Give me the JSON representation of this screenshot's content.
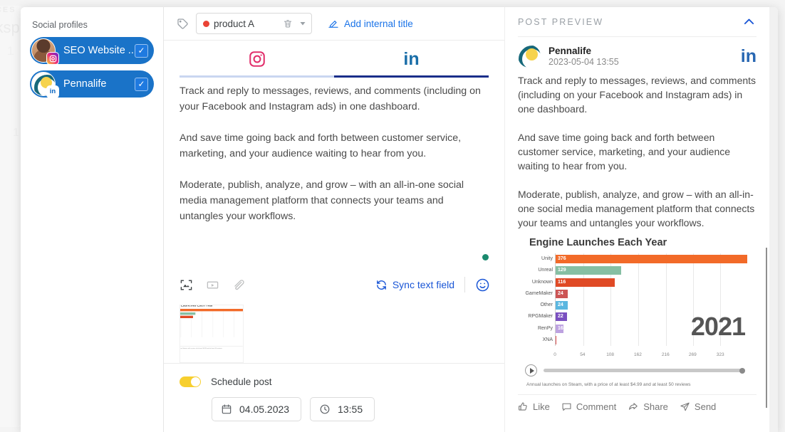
{
  "background": {
    "ghost_eyebrow": "ACES",
    "ghost_title": "orksp",
    "ghost_num": "1",
    "ghost_num2": "1"
  },
  "profiles": {
    "title": "Social profiles",
    "items": [
      {
        "name": "SEO Website ...",
        "network": "instagram",
        "selected": true,
        "check": "✓"
      },
      {
        "name": "Pennalife",
        "network": "linkedin",
        "selected": true,
        "check": "✓"
      }
    ]
  },
  "composer": {
    "tag": {
      "label": "product A",
      "dot_color": "#ea4335",
      "delete_title": "Delete tag",
      "dropdown_title": "Choose tag"
    },
    "add_internal_title": "Add internal title",
    "tabs": [
      {
        "id": "instagram",
        "label": "Instagram",
        "active": false
      },
      {
        "id": "linkedin",
        "label": "LinkedIn",
        "active": true
      }
    ],
    "post_text": "Track and reply to messages, reviews, and comments (including on your Facebook and Instagram ads) in one dashboard.\n\nAnd save time going back and forth between customer service, marketing, and your audience waiting to hear from you.\n\nModerate, publish, analyze, and grow – with an all-in-one social media management platform that connects your teams and untangles your workflows.",
    "media_icons": [
      {
        "name": "add-image-icon",
        "enabled": true
      },
      {
        "name": "add-video-icon",
        "enabled": false
      },
      {
        "name": "add-attachment-icon",
        "enabled": false
      }
    ],
    "sync_label": "Sync text field",
    "emoji_title": "Insert emoji",
    "schedule": {
      "label": "Schedule post",
      "enabled": true,
      "date": "04.05.2023",
      "time": "13:55"
    }
  },
  "preview": {
    "header": "POST PREVIEW",
    "author": "Pennalife",
    "timestamp": "2023-05-04 13:55",
    "network": "linkedin",
    "text": "Track and reply to messages, reviews, and comments (including on your Facebook and Instagram ads) in one dashboard.\n\nAnd save time going back and forth between customer service, marketing, and your audience waiting to hear from you.\n\nModerate, publish, analyze, and grow – with an all-in-one social media management platform that connects your teams and untangles your workflows.",
    "actions": [
      {
        "label": "Like",
        "icon": "thumbs-up-icon"
      },
      {
        "label": "Comment",
        "icon": "comment-icon"
      },
      {
        "label": "Share",
        "icon": "share-icon"
      },
      {
        "label": "Send",
        "icon": "send-icon"
      }
    ]
  },
  "chart_data": {
    "type": "bar",
    "orientation": "horizontal",
    "title": "Engine Launches Each Year",
    "caption": "Annual launches on Steam, with a price of at least $4.99 and at least 50 reviews",
    "year_label": "2021",
    "xlabel": "",
    "ylabel": "",
    "xlim": [
      0,
      377
    ],
    "xticks": [
      0,
      54,
      108,
      162,
      216,
      269,
      323
    ],
    "grid": true,
    "legend": "none",
    "categories": [
      "Unity",
      "Unreal",
      "Unknown",
      "GameMaker",
      "Other",
      "RPGMaker",
      "RenPy",
      "XNA"
    ],
    "values": [
      376,
      129,
      116,
      24,
      24,
      22,
      16,
      1
    ],
    "colors": [
      "#f26a28",
      "#86bfa3",
      "#e04a25",
      "#cc5555",
      "#5bb7e0",
      "#7a4fc0",
      "#bda2e0",
      "#e05050"
    ],
    "playback": {
      "play_label": "Play",
      "progress": 100
    }
  }
}
